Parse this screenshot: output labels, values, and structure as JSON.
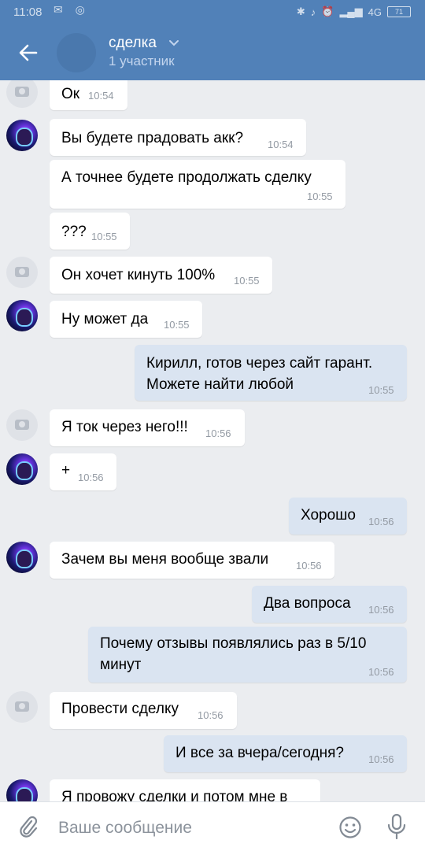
{
  "status": {
    "time": "11:08",
    "network": "4G",
    "battery": "71"
  },
  "header": {
    "title": "сделка",
    "subtitle": "1 участник"
  },
  "messages": [
    {
      "text": "Ок",
      "time": "10:54"
    },
    {
      "text": "Вы будете прадовать акк?",
      "time": "10:54"
    },
    {
      "text": "А точнее будете продолжать сделку",
      "time": "10:55"
    },
    {
      "text": "???",
      "time": "10:55"
    },
    {
      "text": "Он хочет кинуть 100%",
      "time": "10:55"
    },
    {
      "text": "Ну может да",
      "time": "10:55"
    },
    {
      "text1": "Кирилл, готов через сайт гарант.",
      "text2": "Можете найти любой",
      "time": "10:55"
    },
    {
      "text": "Я ток через него!!!",
      "time": "10:56"
    },
    {
      "text": "+",
      "time": "10:56"
    },
    {
      "text": "Хорошо",
      "time": "10:56"
    },
    {
      "text": "Зачем вы меня вообще звали",
      "time": "10:56"
    },
    {
      "text": "Два вопроса",
      "time": "10:56"
    },
    {
      "text1": "Почему отзывы появлялись раз в 5/10",
      "text2": "минут",
      "time": "10:56"
    },
    {
      "text": "Провести сделку",
      "time": "10:56"
    },
    {
      "text": "И все за вчера/сегодня?",
      "time": "10:56"
    },
    {
      "text": "Я провожу сделки и потом мне в"
    }
  ],
  "input": {
    "placeholder": "Ваше сообщение"
  },
  "colors": {
    "header": "#5181b8",
    "background": "#ebedf0",
    "incoming": "#ffffff",
    "outgoing": "#dae4f1"
  }
}
